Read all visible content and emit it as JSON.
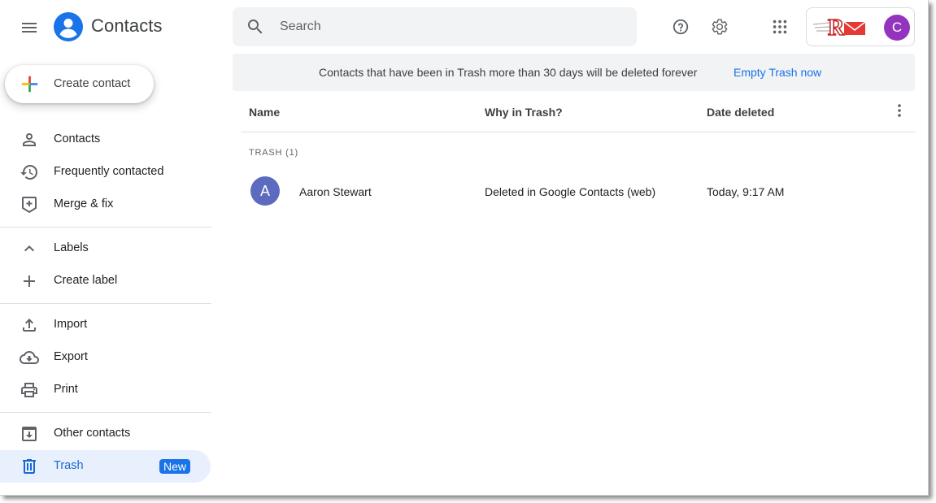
{
  "app": {
    "title": "Contacts"
  },
  "search": {
    "placeholder": "Search"
  },
  "account": {
    "initial": "C",
    "avatar_color": "#9334bf",
    "org_logo_text": "R"
  },
  "create_button": {
    "label": "Create contact"
  },
  "sidebar": {
    "items": [
      {
        "label": "Contacts",
        "icon": "person-icon"
      },
      {
        "label": "Frequently contacted",
        "icon": "history-icon"
      },
      {
        "label": "Merge & fix",
        "icon": "merge-fix-icon"
      },
      {
        "label": "Labels",
        "icon": "chevron-up-icon"
      },
      {
        "label": "Create label",
        "icon": "plus-icon"
      },
      {
        "label": "Import",
        "icon": "upload-icon"
      },
      {
        "label": "Export",
        "icon": "cloud-download-icon"
      },
      {
        "label": "Print",
        "icon": "print-icon"
      },
      {
        "label": "Other contacts",
        "icon": "archive-icon"
      },
      {
        "label": "Trash",
        "icon": "trash-icon",
        "badge": "New",
        "active": true
      }
    ]
  },
  "banner": {
    "text": "Contacts that have been in Trash more than 30 days will be deleted forever",
    "action": "Empty Trash now"
  },
  "table": {
    "columns": [
      "Name",
      "Why in Trash?",
      "Date deleted"
    ],
    "section_label": "TRASH (1)",
    "rows": [
      {
        "initial": "A",
        "name": "Aaron Stewart",
        "reason": "Deleted in Google Contacts (web)",
        "date": "Today, 9:17 AM",
        "avatar_color": "#5c6bc0"
      }
    ]
  },
  "colors": {
    "accent": "#1a73e8",
    "active_bg": "#e8f0fe",
    "surface": "#f1f3f4"
  }
}
